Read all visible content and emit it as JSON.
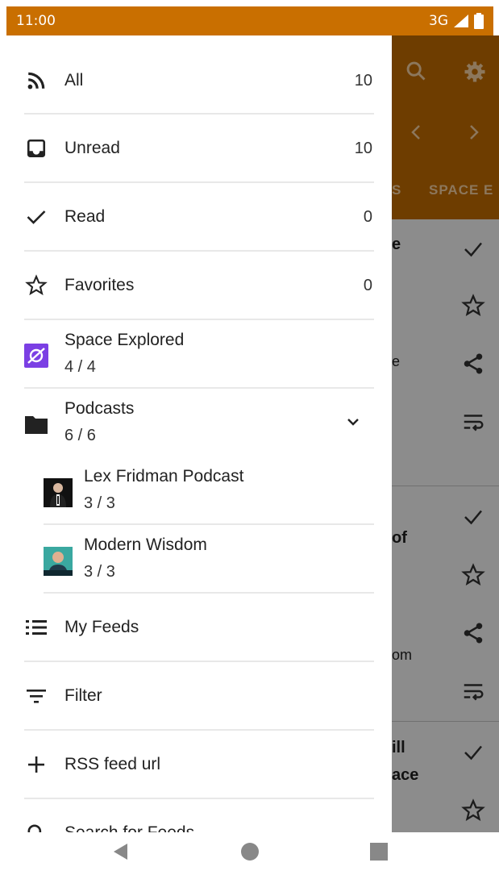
{
  "status_bar": {
    "time": "11:00",
    "network": "3G"
  },
  "background": {
    "tab_partial_left": "S",
    "tab_partial_right": "SPACE E",
    "snippets": [
      "e",
      "e",
      "of",
      "om",
      "ill",
      "ace"
    ]
  },
  "drawer": {
    "items": [
      {
        "label": "All",
        "count": "10",
        "icon": "rss-icon"
      },
      {
        "label": "Unread",
        "count": "10",
        "icon": "inbox-icon"
      },
      {
        "label": "Read",
        "count": "0",
        "icon": "check-icon"
      },
      {
        "label": "Favorites",
        "count": "0",
        "icon": "star-outline-icon"
      }
    ],
    "feeds": [
      {
        "label": "Space Explored",
        "sub": "4 / 4",
        "icon": "space-explored-logo-icon"
      },
      {
        "label": "Podcasts",
        "sub": "6 / 6",
        "icon": "folder-icon",
        "expanded": true,
        "children": [
          {
            "label": "Lex Fridman Podcast",
            "sub": "3 / 3",
            "icon": "lex-fridman-thumbnail-icon"
          },
          {
            "label": "Modern Wisdom",
            "sub": "3 / 3",
            "icon": "modern-wisdom-thumbnail-icon"
          }
        ]
      }
    ],
    "actions": [
      {
        "label": "My Feeds",
        "icon": "list-icon"
      },
      {
        "label": "Filter",
        "icon": "filter-icon"
      },
      {
        "label": "RSS feed url",
        "icon": "plus-icon"
      },
      {
        "label": "Search for Feeds",
        "icon": "search-icon"
      }
    ]
  },
  "colors": {
    "status_bar": "#c96f00",
    "toolbar": "#c96f00",
    "accent_purple": "#7b3fe4"
  }
}
